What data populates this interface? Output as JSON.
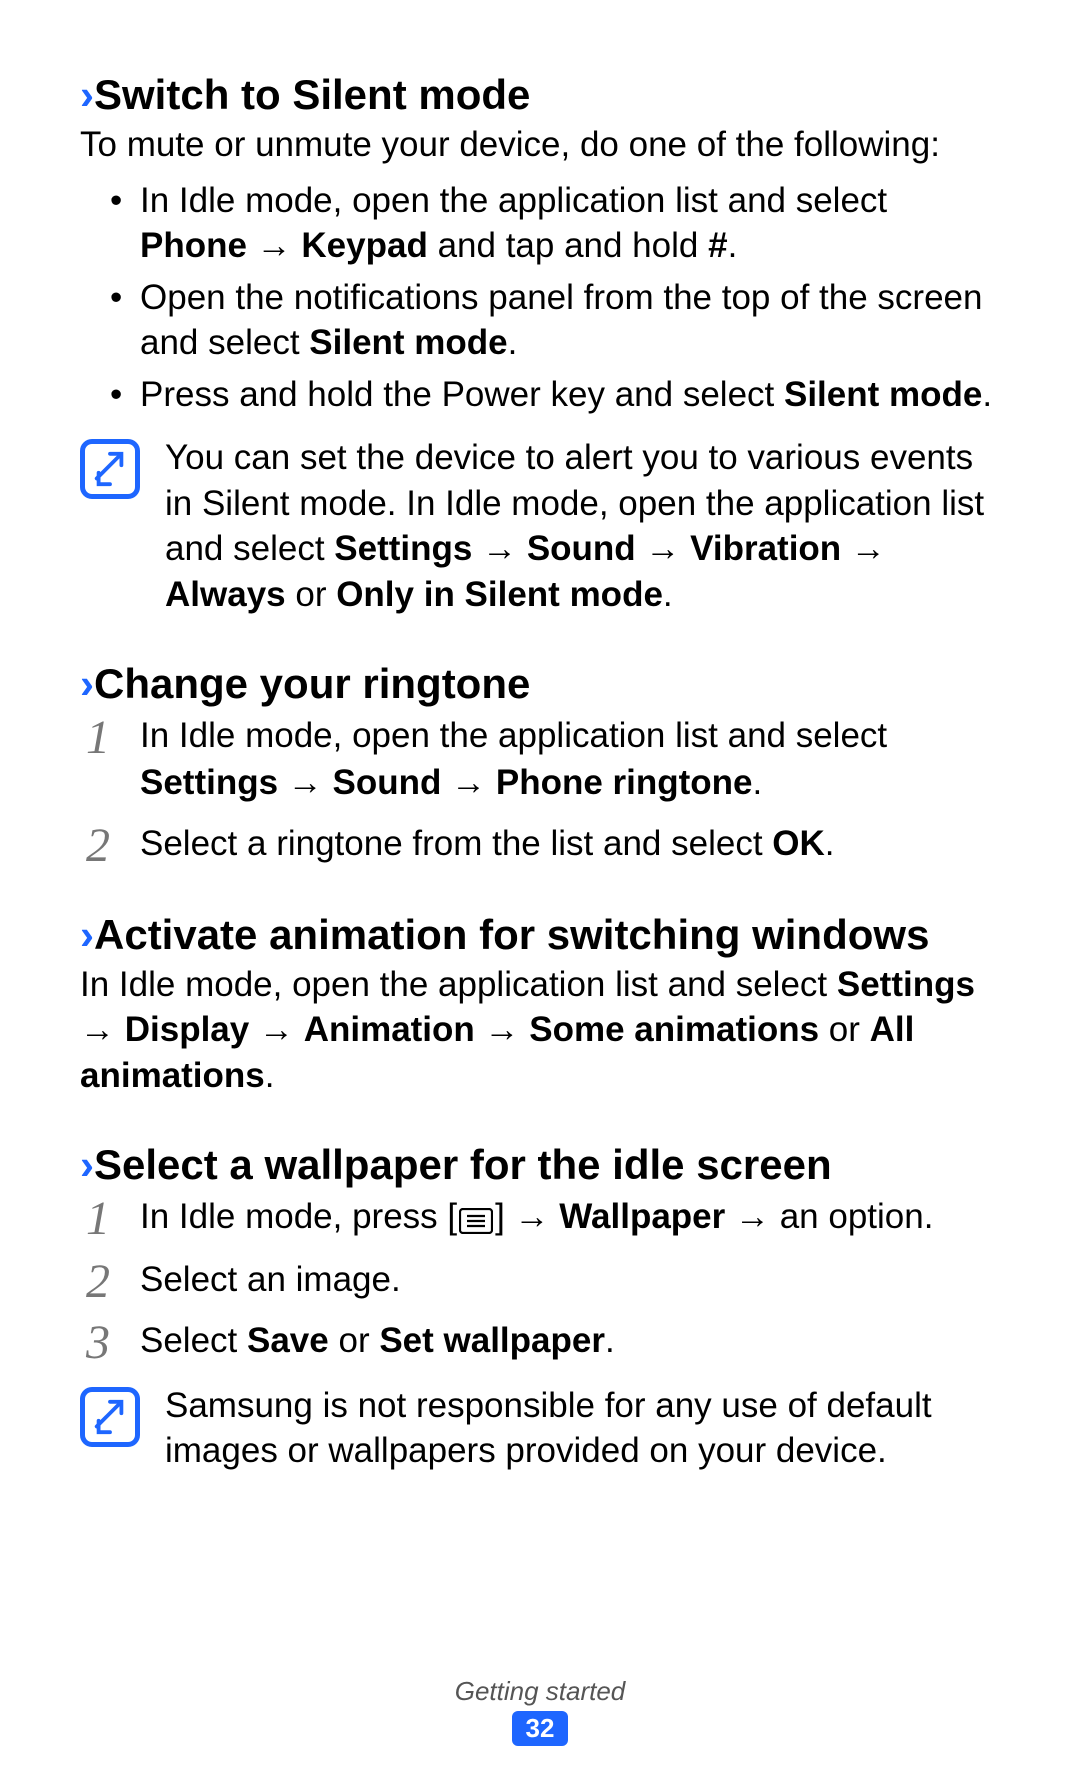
{
  "footer": {
    "section": "Getting started",
    "page": "32"
  },
  "s1": {
    "title": "Switch to Silent mode",
    "intro": "To mute or unmute your device, do one of the following:",
    "b1_pre": "In Idle mode, open the application list and select ",
    "b1_phone": "Phone",
    "b1_arrow": " → ",
    "b1_keypad": "Keypad",
    "b1_post": " and tap and hold ",
    "b1_hash": "#",
    "b1_dot": ".",
    "b2_pre": "Open the notifications panel from the top of the screen and select ",
    "b2_bold": "Silent mode",
    "b2_dot": ".",
    "b3_pre": "Press and hold the Power key and select ",
    "b3_bold": "Silent mode",
    "b3_dot": ".",
    "note_pre": "You can set the device to alert you to various events in Silent mode. In Idle mode, open the application list and select ",
    "note_settings": "Settings",
    "note_a1": " → ",
    "note_sound": "Sound",
    "note_a2": " → ",
    "note_vibration": "Vibration",
    "note_a3": " → ",
    "note_always": "Always",
    "note_or": " or ",
    "note_only": "Only in Silent mode",
    "note_dot": "."
  },
  "s2": {
    "title": "Change your ringtone",
    "st1_pre": "In Idle mode, open the application list and select ",
    "st1_settings": "Settings",
    "st1_a1": " → ",
    "st1_sound": "Sound",
    "st1_a2": " → ",
    "st1_ring": "Phone ringtone",
    "st1_dot": ".",
    "st2_pre": "Select a ringtone from the list and select ",
    "st2_ok": "OK",
    "st2_dot": "."
  },
  "s3": {
    "title": "Activate animation for switching windows",
    "p_pre": "In Idle mode, open the application list and select ",
    "p_settings": "Settings",
    "p_a1": " → ",
    "p_display": "Display",
    "p_a2": " → ",
    "p_animation": "Animation",
    "p_a3": " → ",
    "p_some": "Some animations",
    "p_or": " or ",
    "p_all": "All animations",
    "p_dot": "."
  },
  "s4": {
    "title": "Select a wallpaper for the idle screen",
    "st1_pre": "In Idle mode, press [",
    "st1_post_bracket": "] → ",
    "st1_wall": "Wallpaper",
    "st1_post": " → an option.",
    "st2": "Select an image.",
    "st3_pre": "Select ",
    "st3_save": "Save",
    "st3_or": " or ",
    "st3_set": "Set wallpaper",
    "st3_dot": ".",
    "note": "Samsung is not responsible for any use of default images or wallpapers provided on your device."
  },
  "nums": {
    "n1": "1",
    "n2": "2",
    "n3": "3"
  }
}
